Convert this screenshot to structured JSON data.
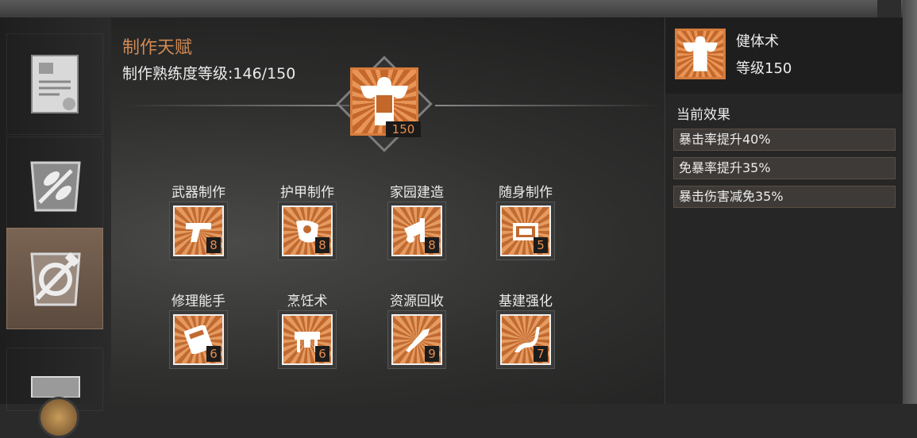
{
  "panel": {
    "title": "制作天赋",
    "level_text": "制作熟练度等级:146/150"
  },
  "featured": {
    "icon": "bodybuilder-icon",
    "level": "150"
  },
  "skills_row1": [
    {
      "name": "武器制作",
      "level": "8",
      "icon": "pistol-icon"
    },
    {
      "name": "护甲制作",
      "level": "8",
      "icon": "armor-icon"
    },
    {
      "name": "家园建造",
      "level": "8",
      "icon": "power-tool-icon"
    },
    {
      "name": "随身制作",
      "level": "5",
      "icon": "crate-icon"
    }
  ],
  "skills_row2": [
    {
      "name": "修理能手",
      "level": "6",
      "icon": "calculator-icon"
    },
    {
      "name": "烹饪术",
      "level": "6",
      "icon": "workbench-icon"
    },
    {
      "name": "资源回收",
      "level": "9",
      "icon": "knife-icon"
    },
    {
      "name": "基建强化",
      "level": "7",
      "icon": "road-icon"
    }
  ],
  "detail": {
    "name": "健体术",
    "level": "等级150",
    "effects_title": "当前效果",
    "effects": [
      "暴击率提升40%",
      "免暴率提升35%",
      "暴击伤害减免35%"
    ]
  },
  "colors": {
    "accent": "#d08a55",
    "tile_orange": "#c16a30"
  }
}
